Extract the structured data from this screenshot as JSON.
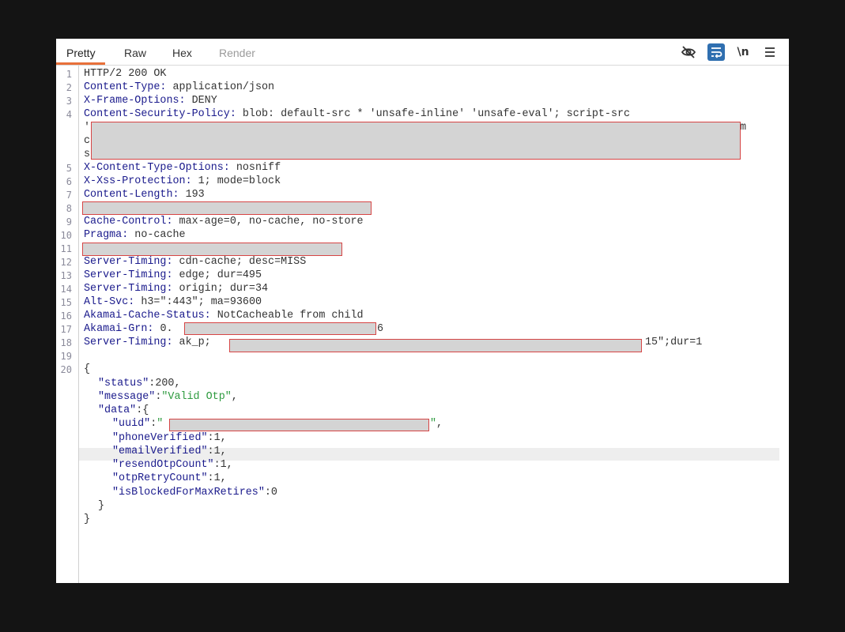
{
  "tabs": [
    {
      "label": "Pretty",
      "state": "active"
    },
    {
      "label": "Raw",
      "state": "normal"
    },
    {
      "label": "Hex",
      "state": "normal"
    },
    {
      "label": "Render",
      "state": "disabled"
    }
  ],
  "toolbar": {
    "icons": [
      "eye-off-icon",
      "word-wrap-icon",
      "newline-icon",
      "menu-icon"
    ],
    "newline_label": "\\n",
    "accent_color": "#e8703a",
    "highlight_color": "#2f6fb0"
  },
  "line_numbers": [
    "1",
    "2",
    "3",
    "4",
    "5",
    "6",
    "7",
    "8",
    "9",
    "10",
    "11",
    "12",
    "13",
    "14",
    "15",
    "16",
    "17",
    "18",
    "19",
    "20"
  ],
  "headers": {
    "status_line": "HTTP/2 200 OK",
    "content_type": {
      "key": "Content-Type:",
      "value": " application/json"
    },
    "x_frame_options": {
      "key": "X-Frame-Options:",
      "value": " DENY"
    },
    "csp": {
      "key": "Content-Security-Policy:",
      "value": " blob: default-src * 'unsafe-inline' 'unsafe-eval'; script-src"
    },
    "csp_frag1": "'",
    "csp_frag2": "m",
    "csp_frag3": "c",
    "csp_frag4": "s",
    "x_content_type_options": {
      "key": "X-Content-Type-Options:",
      "value": " nosniff"
    },
    "x_xss_protection": {
      "key": "X-Xss-Protection:",
      "value": " 1; mode=block"
    },
    "content_length": {
      "key": "Content-Length:",
      "value": " 193"
    },
    "cache_control": {
      "key": "Cache-Control:",
      "value": " max-age=0, no-cache, no-store"
    },
    "pragma": {
      "key": "Pragma:",
      "value": " no-cache"
    },
    "server_timing_1": {
      "key": "Server-Timing:",
      "value": " cdn-cache; desc=MISS"
    },
    "server_timing_2": {
      "key": "Server-Timing:",
      "value": " edge; dur=495"
    },
    "server_timing_3": {
      "key": "Server-Timing:",
      "value": " origin; dur=34"
    },
    "alt_svc": {
      "key": "Alt-Svc:",
      "value": " h3=\":443\"; ma=93600"
    },
    "akamai_cache_status": {
      "key": "Akamai-Cache-Status:",
      "value": " NotCacheable from child"
    },
    "akamai_grn": {
      "key": "Akamai-Grn:",
      "value": " 0.",
      "suffix": "6"
    },
    "server_timing_4": {
      "key": "Server-Timing:",
      "value": " ak_p;",
      "suffix": "15\";dur=1"
    }
  },
  "body": {
    "open_brace": "{",
    "status_key": "\"status\"",
    "status_value": "200",
    "message_key": "\"message\"",
    "message_value": "\"Valid Otp\"",
    "data_key": "\"data\"",
    "data_open": ":{",
    "uuid_key": "\"uuid\"",
    "uuid_open": "\"",
    "uuid_close": "\"",
    "phone_verified_key": "\"phoneVerified\"",
    "phone_verified_value": "1",
    "email_verified_key": "\"emailVerified\"",
    "email_verified_value": "1",
    "resend_otp_count_key": "\"resendOtpCount\"",
    "resend_otp_count_value": "1",
    "otp_retry_count_key": "\"otpRetryCount\"",
    "otp_retry_count_value": "1",
    "is_blocked_key": "\"isBlockedForMaxRetires\"",
    "is_blocked_value": "0",
    "inner_close": "}",
    "outer_close": "}"
  }
}
